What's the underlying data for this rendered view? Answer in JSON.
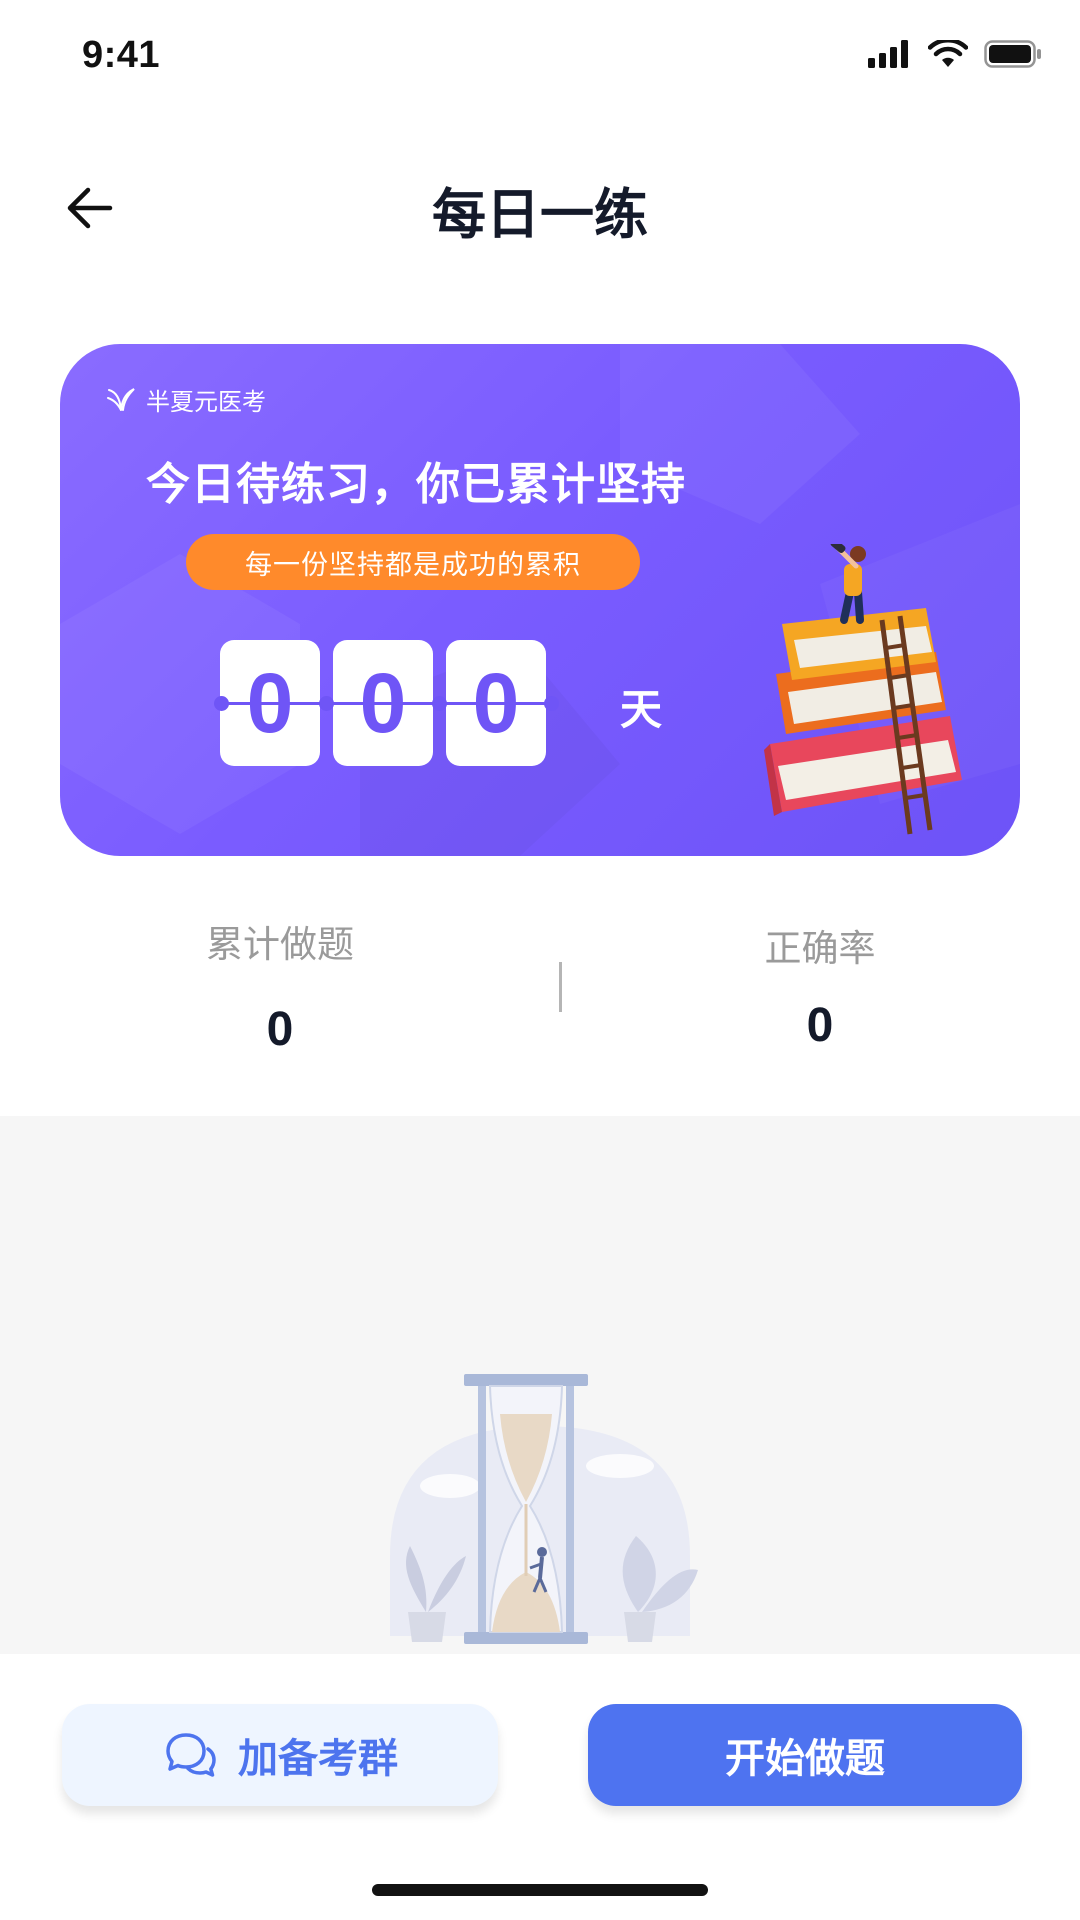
{
  "status_bar": {
    "time": "9:41"
  },
  "header": {
    "title": "每日一练"
  },
  "banner": {
    "brand": "半夏元医考",
    "heading": "今日待练习，你已累计坚持",
    "slogan": "每一份坚持都是成功的累积",
    "digits": [
      "0",
      "0",
      "0"
    ],
    "unit": "天"
  },
  "stats": {
    "total_label": "累计做题",
    "total_value": "0",
    "accuracy_label": "正确率",
    "accuracy_value": "0"
  },
  "buttons": {
    "join_group": "加备考群",
    "start": "开始做题"
  },
  "colors": {
    "banner_purple": "#7a5cff",
    "slogan_orange": "#ff8a2b",
    "primary_blue": "#4e73f0"
  },
  "icons": [
    "signal-icon",
    "wifi-icon",
    "battery-icon",
    "back-arrow-icon",
    "brand-logo-icon",
    "chat-icon"
  ]
}
